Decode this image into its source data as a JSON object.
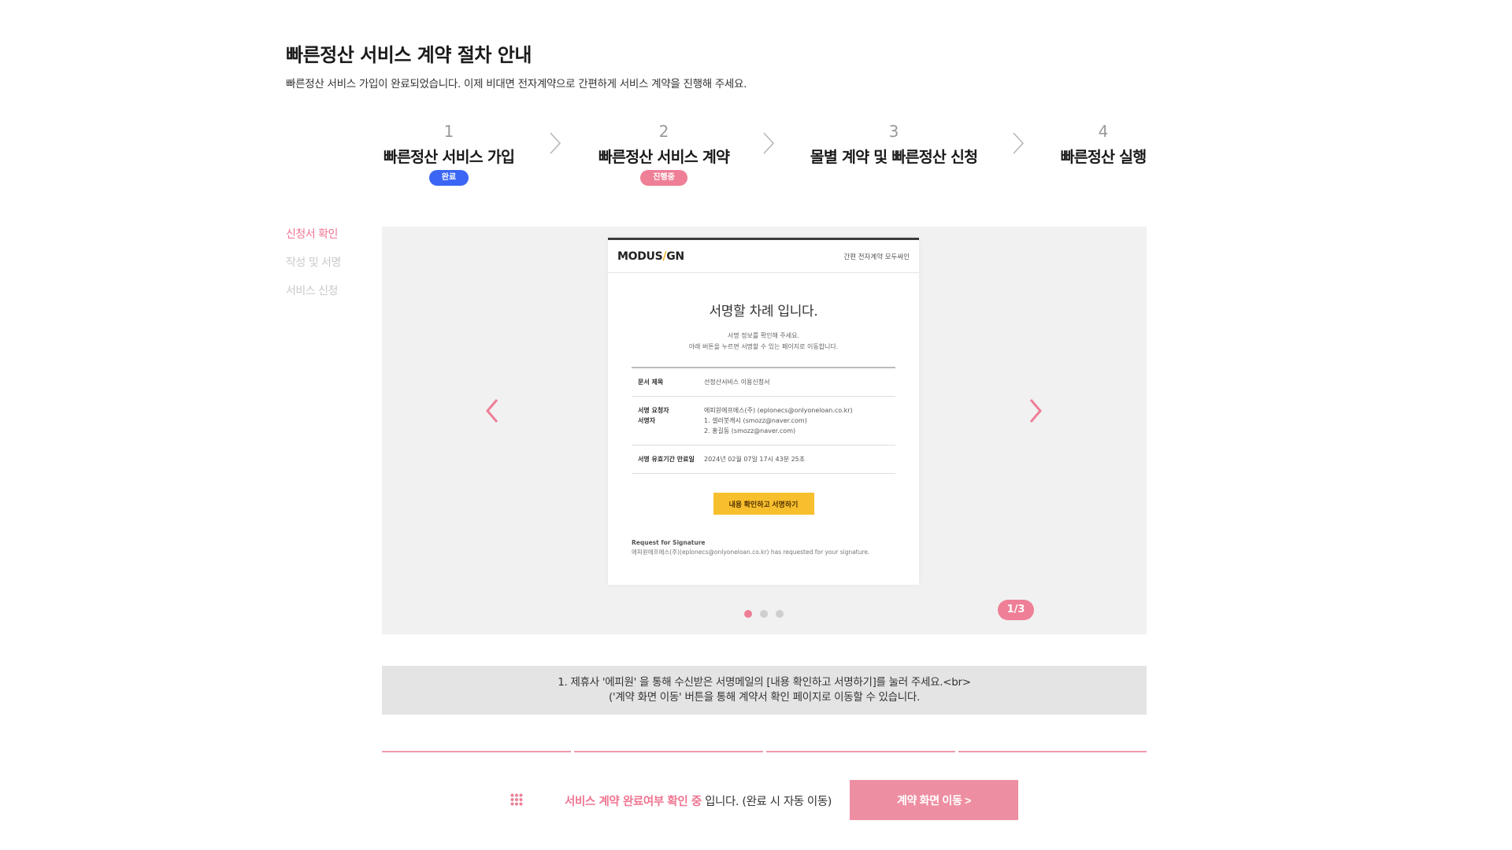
{
  "header": {
    "title": "빠른정산 서비스 계약 절차 안내",
    "description": "빠른정산 서비스 가입이 완료되었습니다. 이제 비대면 전자계약으로 간편하게 서비스 계약을 진행해 주세요."
  },
  "steps": [
    {
      "num": "1",
      "label": "빠른정산 서비스 가입",
      "badge": "완료"
    },
    {
      "num": "2",
      "label": "빠른정산 서비스 계약",
      "badge": "진행중"
    },
    {
      "num": "3",
      "label": "몰별 계약 및 빠른정산 신청"
    },
    {
      "num": "4",
      "label": "빠른정산 실행"
    }
  ],
  "sidebar": {
    "items": [
      {
        "label": "신청서 확인"
      },
      {
        "label": "작성 및 서명"
      },
      {
        "label": "서비스 신청"
      }
    ]
  },
  "carousel": {
    "page_indicator": "1/3",
    "doc": {
      "logo_left": "MODUS",
      "logo_slash": "/",
      "logo_right": "GN",
      "header_right": "간편 전자계약 모두싸인",
      "heading": "서명할 차례 입니다.",
      "sub_line1": "서명 정보를 확인해 주세요.",
      "sub_line2": "아래 버튼을 누르면 서명할 수 있는 페이지로 이동합니다.",
      "rows": {
        "title_key": "문서 제목",
        "title_val": "선정산서비스 이용신청서",
        "requester_key": "서명 요청자",
        "requester_val": "에피원에프에스(주) (eplonecs@onlyoneloan.co.kr)",
        "signer_key": "서명자",
        "signer_val1": "1. 셀러붓캐시 (smozz@naver.com)",
        "signer_val2": "2. 홍길동 (smozz@naver.com)",
        "expiry_key": "서명 유효기간 만료일",
        "expiry_val": "2024년 02월 07일 17시 43분 25초"
      },
      "button": "내용 확인하고 서명하기",
      "foot_title": "Request for Signature",
      "foot_text": "에피원에프에스(주)(eplonecs@onlyoneloan.co.kr) has requested for your signature."
    }
  },
  "notice": {
    "line1": "1. 제휴사 '에피원' 을 통해 수신받은 서명메일의 [내용 확인하고 서명하기]를 눌러 주세요.<br>",
    "line2": "('계약 화면 이동' 버튼을 통해 계약서 확인 페이지로 이동할 수 있습니다."
  },
  "status": {
    "highlight": "서비스 계약 완료여부 확인 중",
    "rest": " 입니다. (완료 시 자동 이동)"
  },
  "go_button": "계약 화면 이동 >",
  "colors": {
    "accent_pink": "#ee7f96",
    "done_blue": "#3b66f5",
    "button_yellow": "#f7bf2d"
  },
  "icons": {
    "prev": "chevron-left-icon",
    "next": "chevron-right-icon",
    "step_sep": "chevron-right-icon",
    "status": "grid-dots-icon"
  }
}
